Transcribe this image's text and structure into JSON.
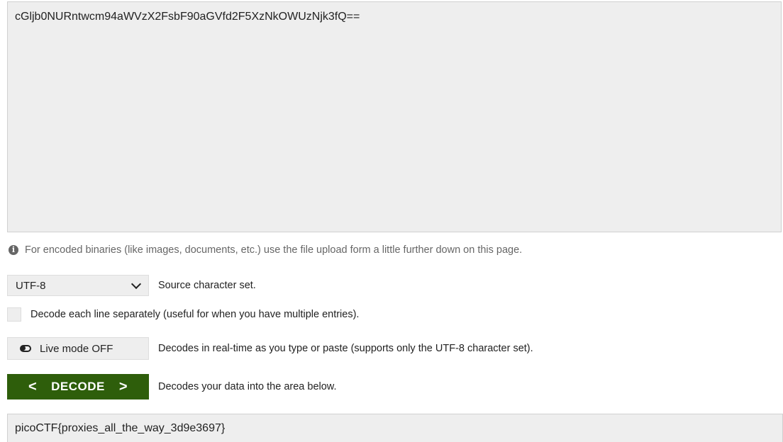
{
  "input": {
    "value": "cGljb0NURntwcm94aWVzX2FsbF90aGVfd2F5XzNkOWUzNjk3fQ=="
  },
  "info": {
    "icon": "info-icon",
    "text": "For encoded binaries (like images, documents, etc.) use the file upload form a little further down on this page."
  },
  "charset": {
    "selected": "UTF-8",
    "description": "Source character set."
  },
  "split_lines": {
    "checked": false,
    "label": "Decode each line separately (useful for when you have multiple entries)."
  },
  "live_mode": {
    "icon": "toggle-icon",
    "label": "Live mode OFF",
    "description": "Decodes in real-time as you type or paste (supports only the UTF-8 character set)."
  },
  "decode": {
    "label": "DECODE",
    "left_arrow": "<",
    "right_arrow": ">",
    "description": "Decodes your data into the area below.",
    "color": "#2e5e0b"
  },
  "output": {
    "value": "picoCTF{proxies_all_the_way_3d9e3697}"
  }
}
